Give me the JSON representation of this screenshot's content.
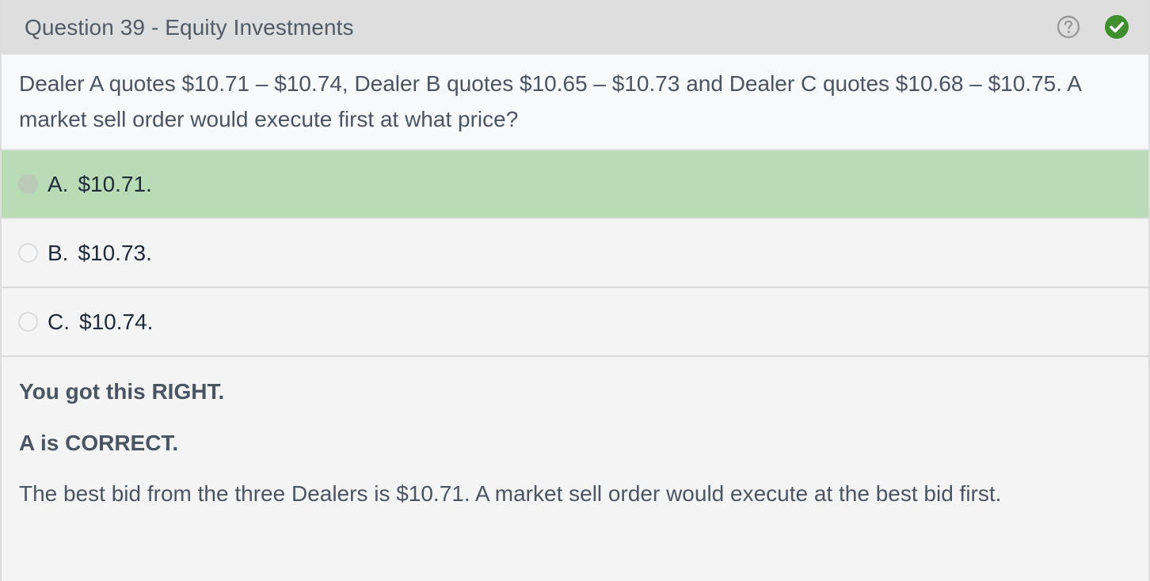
{
  "header": {
    "title": "Question 39 - Equity Investments",
    "help_icon": "question-circle-icon",
    "status_icon": "check-circle-icon",
    "status_color": "#3f8f2f"
  },
  "question": {
    "text": "Dealer A quotes $10.71 – $10.74, Dealer B quotes $10.65 – $10.73 and Dealer C quotes $10.68 – $10.75.  A market sell order would execute first at what price?"
  },
  "options": [
    {
      "letter": "A.",
      "text": "$10.71.",
      "state": "correct"
    },
    {
      "letter": "B.",
      "text": "$10.73.",
      "state": "neutral"
    },
    {
      "letter": "C.",
      "text": "$10.74.",
      "state": "neutral"
    }
  ],
  "feedback": {
    "result": "You got this RIGHT.",
    "correct_answer": "A is CORRECT.",
    "explanation": "The best bid from the three Dealers is $10.71.  A market sell order would execute at the best bid first."
  },
  "colors": {
    "correct_highlight": "#b9dbb6",
    "header_bg": "#dedede"
  }
}
